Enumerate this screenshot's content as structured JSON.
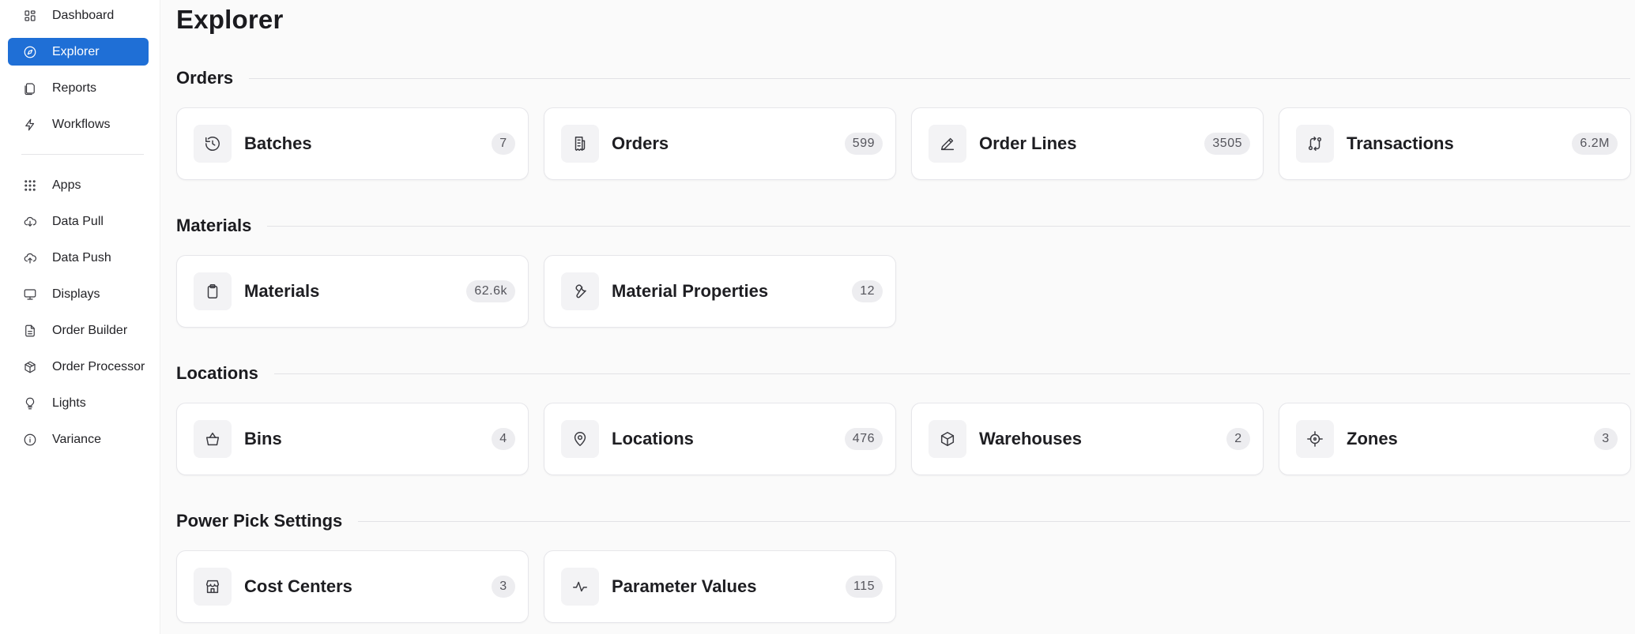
{
  "sidebar": {
    "items": [
      {
        "label": "Dashboard",
        "icon": "dashboard-icon"
      },
      {
        "label": "Explorer",
        "icon": "compass-icon",
        "active": true
      },
      {
        "label": "Reports",
        "icon": "reports-icon"
      },
      {
        "label": "Workflows",
        "icon": "bolt-icon"
      },
      {
        "label": "Apps",
        "icon": "grid-icon"
      },
      {
        "label": "Data Pull",
        "icon": "cloud-download-icon"
      },
      {
        "label": "Data Push",
        "icon": "cloud-upload-icon"
      },
      {
        "label": "Displays",
        "icon": "monitor-icon"
      },
      {
        "label": "Order Builder",
        "icon": "document-icon"
      },
      {
        "label": "Order Processor",
        "icon": "package-icon"
      },
      {
        "label": "Lights",
        "icon": "bulb-icon"
      },
      {
        "label": "Variance",
        "icon": "info-icon"
      }
    ]
  },
  "main": {
    "title": "Explorer",
    "sections": [
      {
        "label": "Orders",
        "cards": [
          {
            "name": "Batches",
            "count": "7",
            "icon": "history-icon"
          },
          {
            "name": "Orders",
            "count": "599",
            "icon": "receipt-icon"
          },
          {
            "name": "Order Lines",
            "count": "3505",
            "icon": "pencil-icon"
          },
          {
            "name": "Transactions",
            "count": "6.2M",
            "icon": "transfer-icon"
          }
        ]
      },
      {
        "label": "Materials",
        "cards": [
          {
            "name": "Materials",
            "count": "62.6k",
            "icon": "clipboard-icon"
          },
          {
            "name": "Material Properties",
            "count": "12",
            "icon": "wrench-icon"
          }
        ]
      },
      {
        "label": "Locations",
        "cards": [
          {
            "name": "Bins",
            "count": "4",
            "icon": "basket-icon"
          },
          {
            "name": "Locations",
            "count": "476",
            "icon": "map-pin-icon"
          },
          {
            "name": "Warehouses",
            "count": "2",
            "icon": "box-icon"
          },
          {
            "name": "Zones",
            "count": "3",
            "icon": "target-icon"
          }
        ]
      },
      {
        "label": "Power Pick Settings",
        "cards": [
          {
            "name": "Cost Centers",
            "count": "3",
            "icon": "store-icon"
          },
          {
            "name": "Parameter Values",
            "count": "115",
            "icon": "activity-icon"
          }
        ]
      }
    ]
  },
  "colors": {
    "accent": "#1f6fd6",
    "background": "#fafafa"
  }
}
